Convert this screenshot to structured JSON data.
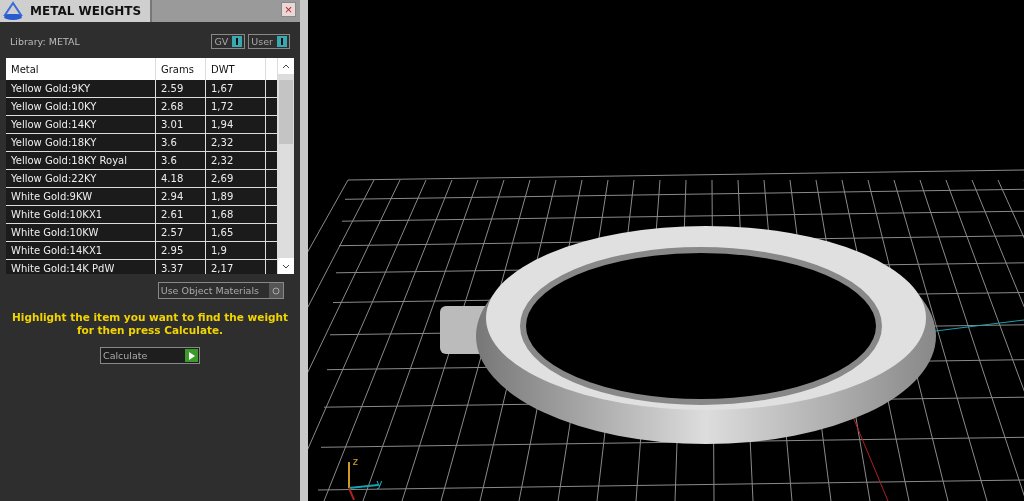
{
  "panel": {
    "title": "METAL WEIGHTS",
    "close": "×",
    "library": "Library: METAL",
    "toggles": [
      {
        "label": "GV",
        "on": true
      },
      {
        "label": "User",
        "on": true
      }
    ],
    "table": {
      "columns": [
        "Metal",
        "Grams",
        "DWT"
      ],
      "rows": [
        {
          "metal": "Yellow Gold:9KY",
          "grams": "2.59",
          "dwt": "1,67"
        },
        {
          "metal": "Yellow Gold:10KY",
          "grams": "2.68",
          "dwt": "1,72"
        },
        {
          "metal": "Yellow Gold:14KY",
          "grams": "3.01",
          "dwt": "1,94"
        },
        {
          "metal": "Yellow Gold:18KY",
          "grams": "3.6",
          "dwt": "2,32"
        },
        {
          "metal": "Yellow Gold:18KY Royal",
          "grams": "3.6",
          "dwt": "2,32"
        },
        {
          "metal": "Yellow Gold:22KY",
          "grams": "4.18",
          "dwt": "2,69"
        },
        {
          "metal": "White Gold:9KW",
          "grams": "2.94",
          "dwt": "1,89"
        },
        {
          "metal": "White Gold:10KX1",
          "grams": "2.61",
          "dwt": "1,68"
        },
        {
          "metal": "White Gold:10KW",
          "grams": "2.57",
          "dwt": "1,65"
        },
        {
          "metal": "White Gold:14KX1",
          "grams": "2.95",
          "dwt": "1,9"
        },
        {
          "metal": "White Gold:14K PdW",
          "grams": "3.37",
          "dwt": "2,17"
        }
      ]
    },
    "use_object_materials": {
      "label": "Use Object Materials",
      "checked": false
    },
    "hint": "Highlight the item you want to find the weight for then press Calculate.",
    "calculate": "Calculate"
  },
  "viewport": {
    "axes": [
      "z",
      "y"
    ]
  }
}
